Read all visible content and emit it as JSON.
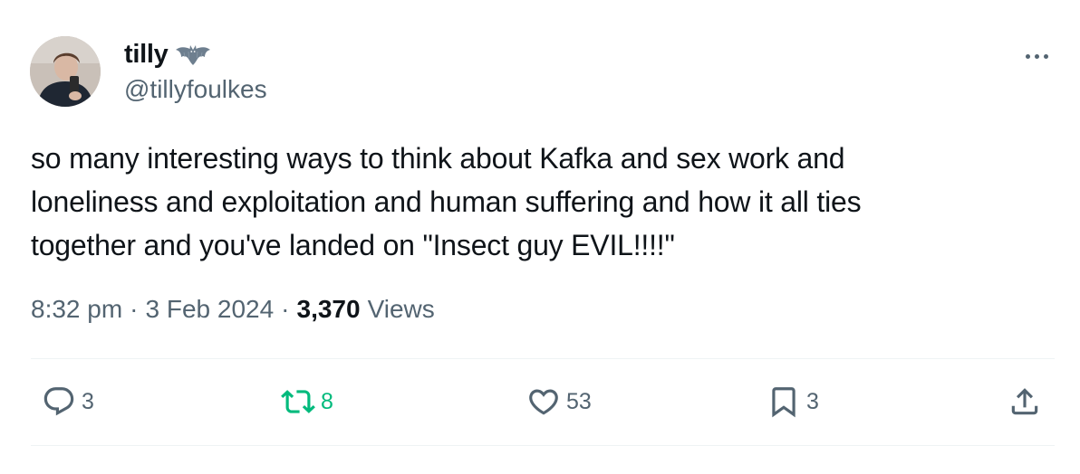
{
  "author": {
    "display_name": "tilly",
    "handle": "@tillyfoulkes",
    "badge_icon": "bat-icon"
  },
  "tweet": {
    "text_lines": [
      "so many interesting ways to think about Kafka and sex work and",
      "loneliness and exploitation and human suffering and how it all ties",
      "together and you've landed on \"Insect guy EVIL!!!!\""
    ],
    "time": "8:32 pm",
    "date": "3 Feb 2024",
    "views_count": "3,370",
    "views_label": "Views",
    "separator": "·"
  },
  "actions": {
    "reply": {
      "icon": "reply-icon",
      "count": "3"
    },
    "retweet": {
      "icon": "retweet-icon",
      "count": "8",
      "color": "#00ba7c"
    },
    "like": {
      "icon": "heart-icon",
      "count": "53"
    },
    "bookmark": {
      "icon": "bookmark-icon",
      "count": "3"
    },
    "share": {
      "icon": "share-icon"
    }
  },
  "colors": {
    "text_primary": "#0f1419",
    "text_secondary": "#536471",
    "divider": "#eff3f4",
    "retweet_active": "#00ba7c"
  }
}
